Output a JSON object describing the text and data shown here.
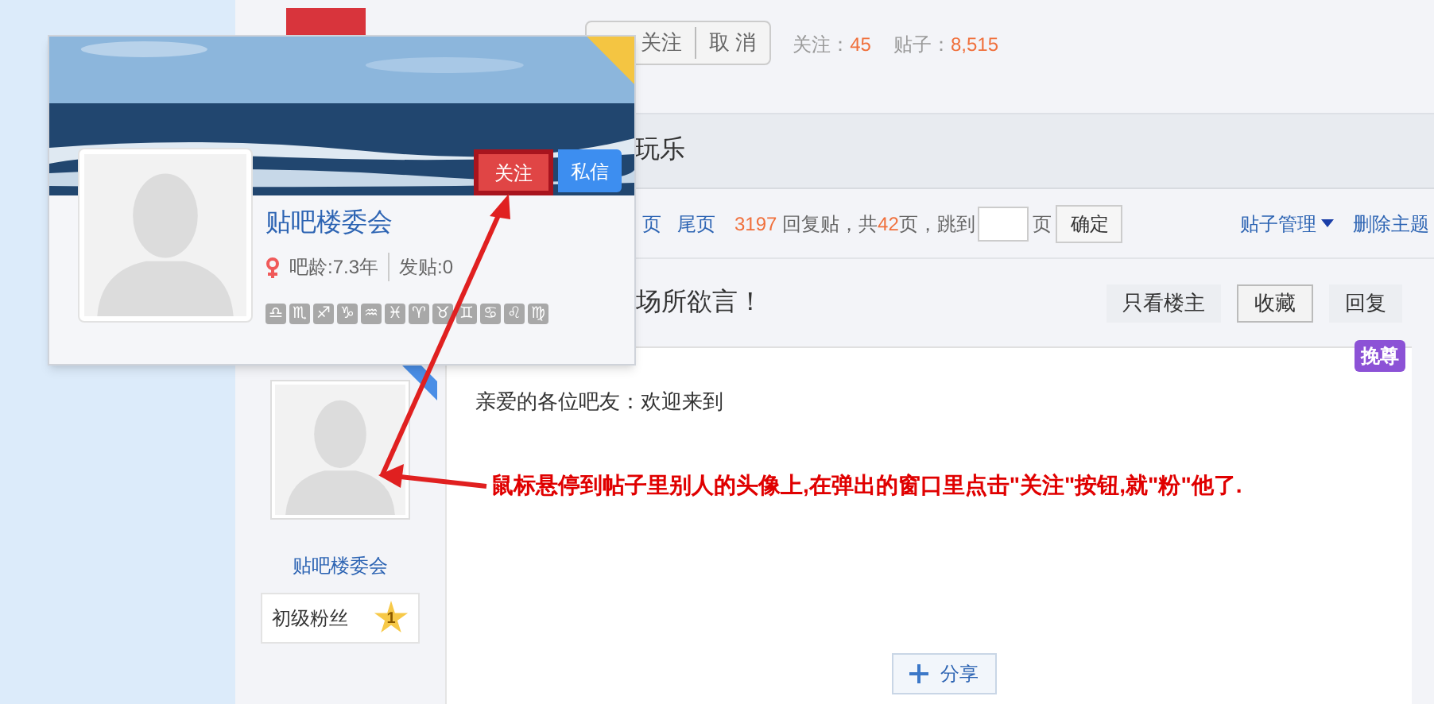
{
  "header": {
    "follow_button": "关注",
    "cancel_button": "取 消",
    "follow_label": "关注：",
    "follow_count": "45",
    "posts_label": "贴子：",
    "posts_count": "8,515"
  },
  "forum_tab": "玩乐",
  "pager": {
    "prev_fragment": "页",
    "last_page": "尾页",
    "replies": "3197",
    "replies_text": " 回复贴，共",
    "pages": "42",
    "pages_text": "页，跳到",
    "page_suffix": "页",
    "confirm": "确定",
    "manage": "贴子管理",
    "delete": "删除主题"
  },
  "thread": {
    "title": "场所欲言！",
    "actions": [
      {
        "label": "只看楼主",
        "selected": false
      },
      {
        "label": "收藏",
        "selected": true
      },
      {
        "label": "回复",
        "selected": false
      }
    ]
  },
  "post": {
    "author": "贴吧楼委会",
    "rank": "初级粉丝",
    "level": "1",
    "badge": "挽尊",
    "body": "亲爱的各位吧友：欢迎来到",
    "annotation": "鼠标悬停到帖子里别人的头像上,在弹出的窗口里点击\"关注\"按钮,就\"粉\"他了.",
    "share": "分享"
  },
  "popup": {
    "name": "贴吧楼委会",
    "female": true,
    "age": "吧龄:7.3年",
    "posts": "发贴:0",
    "follow": "关注",
    "follow_highlighted": true,
    "message": "私信",
    "zodiac": [
      "♎",
      "♏",
      "♐",
      "♑",
      "♒",
      "♓",
      "♈",
      "♉",
      "♊",
      "♋",
      "♌",
      "♍"
    ]
  }
}
